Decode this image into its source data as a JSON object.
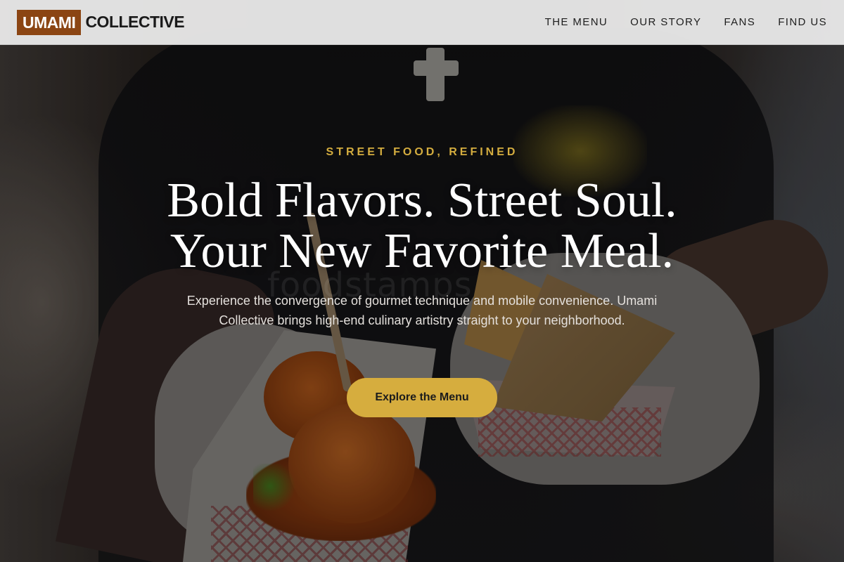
{
  "brand": {
    "box_text": "UMAMI",
    "text": "COLLECTIVE"
  },
  "nav": {
    "items": [
      {
        "label": "THE MENU"
      },
      {
        "label": "OUR STORY"
      },
      {
        "label": "FANS"
      },
      {
        "label": "FIND US"
      }
    ]
  },
  "hero": {
    "eyebrow": "STREET FOOD, REFINED",
    "headline_line1": "Bold Flavors. Street Soul.",
    "headline_line2": "Your New Favorite Meal.",
    "subtext": "Experience the convergence of gourmet technique and mobile convenience. Umami Collective brings high-end culinary artistry straight to your neighborhood.",
    "cta_label": "Explore the Menu",
    "watermark": "foodstamps"
  },
  "colors": {
    "brand_accent": "#8b4513",
    "gold": "#d4ad3f",
    "nav_bg": "#e8e8e8"
  }
}
